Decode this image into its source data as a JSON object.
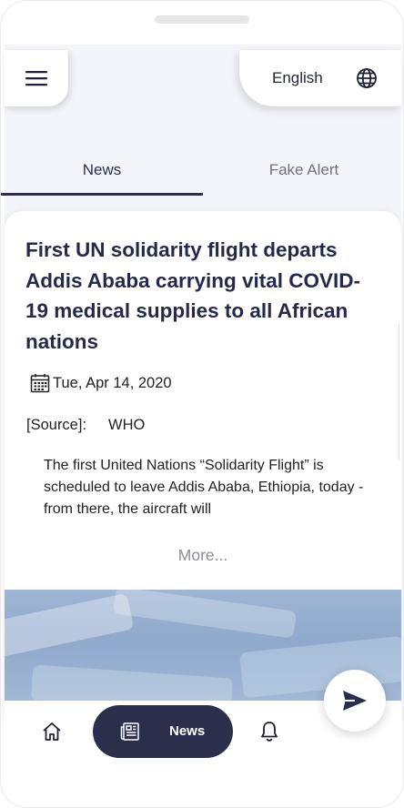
{
  "header": {
    "language_label": "English",
    "menu_icon": "hamburger-menu-icon",
    "language_icon": "globe-icon"
  },
  "tabs": [
    {
      "label": "News",
      "active": true
    },
    {
      "label": "Fake Alert",
      "active": false
    }
  ],
  "article": {
    "headline": "First UN solidarity flight departs Addis Ababa carrying vital COVID-19 medical supplies to all African nations",
    "date_icon": "calendar-icon",
    "date": "Tue, Apr 14, 2020",
    "source_label": "[Source]:",
    "source_value": "WHO",
    "excerpt": "The first United Nations “Solidarity Flight” is scheduled to leave Addis Ababa, Ethiopia, today - from there, the aircraft will",
    "more_label": "More..."
  },
  "bottom_nav": {
    "home_icon": "home-icon",
    "news_icon": "newspaper-icon",
    "news_label": "News",
    "notifications_icon": "bell-icon"
  },
  "fab": {
    "icon": "send-icon"
  },
  "colors": {
    "primary": "#2b2f4c",
    "background": "#f4f5fa",
    "muted": "#8c8c94"
  }
}
